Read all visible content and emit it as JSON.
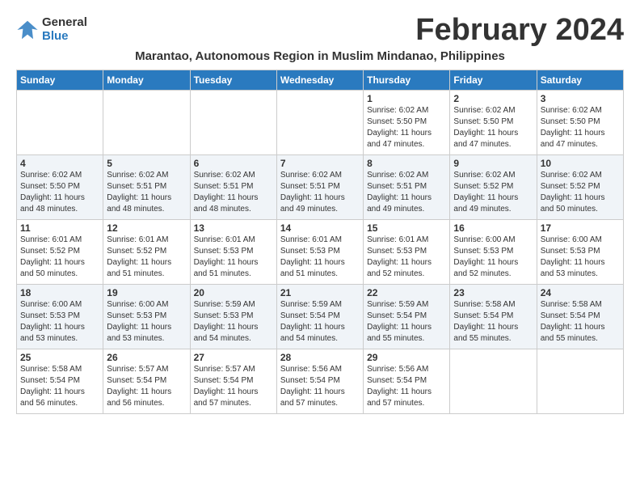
{
  "logo": {
    "general": "General",
    "blue": "Blue"
  },
  "title": "February 2024",
  "subtitle": "Marantao, Autonomous Region in Muslim Mindanao, Philippines",
  "days_of_week": [
    "Sunday",
    "Monday",
    "Tuesday",
    "Wednesday",
    "Thursday",
    "Friday",
    "Saturday"
  ],
  "weeks": [
    [
      {
        "day": "",
        "info": ""
      },
      {
        "day": "",
        "info": ""
      },
      {
        "day": "",
        "info": ""
      },
      {
        "day": "",
        "info": ""
      },
      {
        "day": "1",
        "info": "Sunrise: 6:02 AM\nSunset: 5:50 PM\nDaylight: 11 hours and 47 minutes."
      },
      {
        "day": "2",
        "info": "Sunrise: 6:02 AM\nSunset: 5:50 PM\nDaylight: 11 hours and 47 minutes."
      },
      {
        "day": "3",
        "info": "Sunrise: 6:02 AM\nSunset: 5:50 PM\nDaylight: 11 hours and 47 minutes."
      }
    ],
    [
      {
        "day": "4",
        "info": "Sunrise: 6:02 AM\nSunset: 5:50 PM\nDaylight: 11 hours and 48 minutes."
      },
      {
        "day": "5",
        "info": "Sunrise: 6:02 AM\nSunset: 5:51 PM\nDaylight: 11 hours and 48 minutes."
      },
      {
        "day": "6",
        "info": "Sunrise: 6:02 AM\nSunset: 5:51 PM\nDaylight: 11 hours and 48 minutes."
      },
      {
        "day": "7",
        "info": "Sunrise: 6:02 AM\nSunset: 5:51 PM\nDaylight: 11 hours and 49 minutes."
      },
      {
        "day": "8",
        "info": "Sunrise: 6:02 AM\nSunset: 5:51 PM\nDaylight: 11 hours and 49 minutes."
      },
      {
        "day": "9",
        "info": "Sunrise: 6:02 AM\nSunset: 5:52 PM\nDaylight: 11 hours and 49 minutes."
      },
      {
        "day": "10",
        "info": "Sunrise: 6:02 AM\nSunset: 5:52 PM\nDaylight: 11 hours and 50 minutes."
      }
    ],
    [
      {
        "day": "11",
        "info": "Sunrise: 6:01 AM\nSunset: 5:52 PM\nDaylight: 11 hours and 50 minutes."
      },
      {
        "day": "12",
        "info": "Sunrise: 6:01 AM\nSunset: 5:52 PM\nDaylight: 11 hours and 51 minutes."
      },
      {
        "day": "13",
        "info": "Sunrise: 6:01 AM\nSunset: 5:53 PM\nDaylight: 11 hours and 51 minutes."
      },
      {
        "day": "14",
        "info": "Sunrise: 6:01 AM\nSunset: 5:53 PM\nDaylight: 11 hours and 51 minutes."
      },
      {
        "day": "15",
        "info": "Sunrise: 6:01 AM\nSunset: 5:53 PM\nDaylight: 11 hours and 52 minutes."
      },
      {
        "day": "16",
        "info": "Sunrise: 6:00 AM\nSunset: 5:53 PM\nDaylight: 11 hours and 52 minutes."
      },
      {
        "day": "17",
        "info": "Sunrise: 6:00 AM\nSunset: 5:53 PM\nDaylight: 11 hours and 53 minutes."
      }
    ],
    [
      {
        "day": "18",
        "info": "Sunrise: 6:00 AM\nSunset: 5:53 PM\nDaylight: 11 hours and 53 minutes."
      },
      {
        "day": "19",
        "info": "Sunrise: 6:00 AM\nSunset: 5:53 PM\nDaylight: 11 hours and 53 minutes."
      },
      {
        "day": "20",
        "info": "Sunrise: 5:59 AM\nSunset: 5:53 PM\nDaylight: 11 hours and 54 minutes."
      },
      {
        "day": "21",
        "info": "Sunrise: 5:59 AM\nSunset: 5:54 PM\nDaylight: 11 hours and 54 minutes."
      },
      {
        "day": "22",
        "info": "Sunrise: 5:59 AM\nSunset: 5:54 PM\nDaylight: 11 hours and 55 minutes."
      },
      {
        "day": "23",
        "info": "Sunrise: 5:58 AM\nSunset: 5:54 PM\nDaylight: 11 hours and 55 minutes."
      },
      {
        "day": "24",
        "info": "Sunrise: 5:58 AM\nSunset: 5:54 PM\nDaylight: 11 hours and 55 minutes."
      }
    ],
    [
      {
        "day": "25",
        "info": "Sunrise: 5:58 AM\nSunset: 5:54 PM\nDaylight: 11 hours and 56 minutes."
      },
      {
        "day": "26",
        "info": "Sunrise: 5:57 AM\nSunset: 5:54 PM\nDaylight: 11 hours and 56 minutes."
      },
      {
        "day": "27",
        "info": "Sunrise: 5:57 AM\nSunset: 5:54 PM\nDaylight: 11 hours and 57 minutes."
      },
      {
        "day": "28",
        "info": "Sunrise: 5:56 AM\nSunset: 5:54 PM\nDaylight: 11 hours and 57 minutes."
      },
      {
        "day": "29",
        "info": "Sunrise: 5:56 AM\nSunset: 5:54 PM\nDaylight: 11 hours and 57 minutes."
      },
      {
        "day": "",
        "info": ""
      },
      {
        "day": "",
        "info": ""
      }
    ]
  ]
}
